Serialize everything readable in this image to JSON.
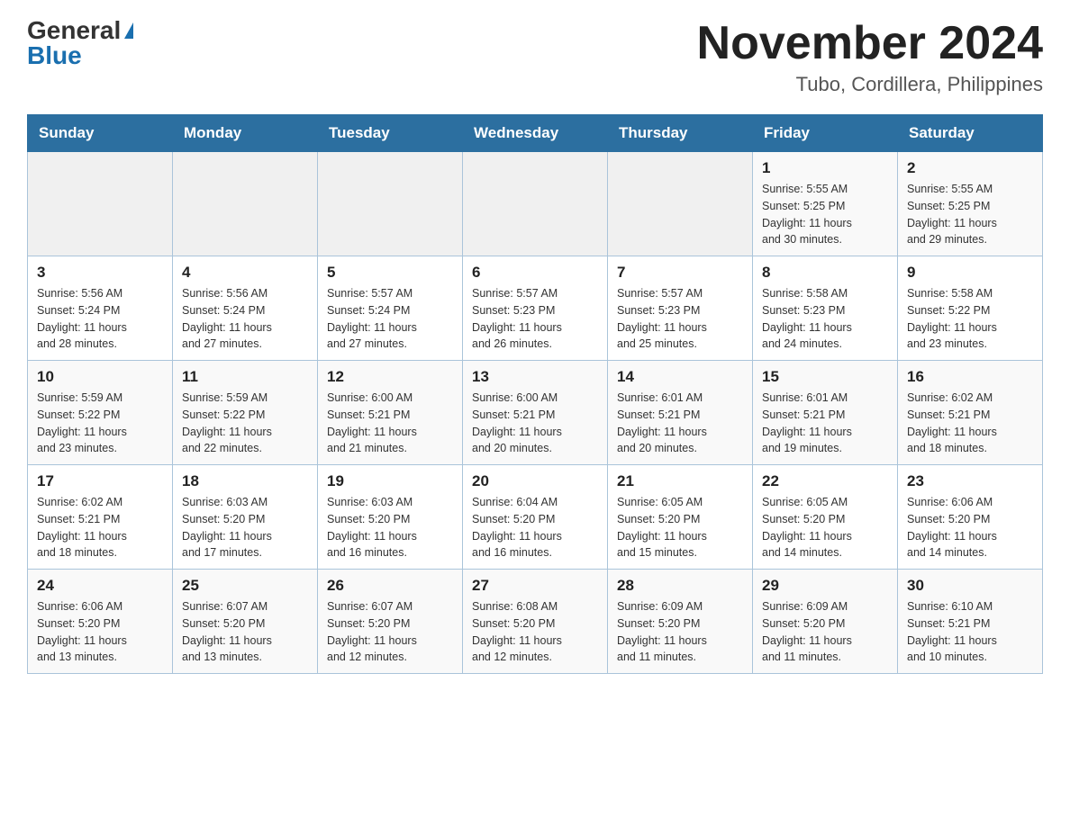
{
  "header": {
    "logo_general": "General",
    "logo_blue": "Blue",
    "month_title": "November 2024",
    "subtitle": "Tubo, Cordillera, Philippines"
  },
  "weekdays": [
    "Sunday",
    "Monday",
    "Tuesday",
    "Wednesday",
    "Thursday",
    "Friday",
    "Saturday"
  ],
  "weeks": [
    [
      {
        "day": "",
        "info": ""
      },
      {
        "day": "",
        "info": ""
      },
      {
        "day": "",
        "info": ""
      },
      {
        "day": "",
        "info": ""
      },
      {
        "day": "",
        "info": ""
      },
      {
        "day": "1",
        "info": "Sunrise: 5:55 AM\nSunset: 5:25 PM\nDaylight: 11 hours\nand 30 minutes."
      },
      {
        "day": "2",
        "info": "Sunrise: 5:55 AM\nSunset: 5:25 PM\nDaylight: 11 hours\nand 29 minutes."
      }
    ],
    [
      {
        "day": "3",
        "info": "Sunrise: 5:56 AM\nSunset: 5:24 PM\nDaylight: 11 hours\nand 28 minutes."
      },
      {
        "day": "4",
        "info": "Sunrise: 5:56 AM\nSunset: 5:24 PM\nDaylight: 11 hours\nand 27 minutes."
      },
      {
        "day": "5",
        "info": "Sunrise: 5:57 AM\nSunset: 5:24 PM\nDaylight: 11 hours\nand 27 minutes."
      },
      {
        "day": "6",
        "info": "Sunrise: 5:57 AM\nSunset: 5:23 PM\nDaylight: 11 hours\nand 26 minutes."
      },
      {
        "day": "7",
        "info": "Sunrise: 5:57 AM\nSunset: 5:23 PM\nDaylight: 11 hours\nand 25 minutes."
      },
      {
        "day": "8",
        "info": "Sunrise: 5:58 AM\nSunset: 5:23 PM\nDaylight: 11 hours\nand 24 minutes."
      },
      {
        "day": "9",
        "info": "Sunrise: 5:58 AM\nSunset: 5:22 PM\nDaylight: 11 hours\nand 23 minutes."
      }
    ],
    [
      {
        "day": "10",
        "info": "Sunrise: 5:59 AM\nSunset: 5:22 PM\nDaylight: 11 hours\nand 23 minutes."
      },
      {
        "day": "11",
        "info": "Sunrise: 5:59 AM\nSunset: 5:22 PM\nDaylight: 11 hours\nand 22 minutes."
      },
      {
        "day": "12",
        "info": "Sunrise: 6:00 AM\nSunset: 5:21 PM\nDaylight: 11 hours\nand 21 minutes."
      },
      {
        "day": "13",
        "info": "Sunrise: 6:00 AM\nSunset: 5:21 PM\nDaylight: 11 hours\nand 20 minutes."
      },
      {
        "day": "14",
        "info": "Sunrise: 6:01 AM\nSunset: 5:21 PM\nDaylight: 11 hours\nand 20 minutes."
      },
      {
        "day": "15",
        "info": "Sunrise: 6:01 AM\nSunset: 5:21 PM\nDaylight: 11 hours\nand 19 minutes."
      },
      {
        "day": "16",
        "info": "Sunrise: 6:02 AM\nSunset: 5:21 PM\nDaylight: 11 hours\nand 18 minutes."
      }
    ],
    [
      {
        "day": "17",
        "info": "Sunrise: 6:02 AM\nSunset: 5:21 PM\nDaylight: 11 hours\nand 18 minutes."
      },
      {
        "day": "18",
        "info": "Sunrise: 6:03 AM\nSunset: 5:20 PM\nDaylight: 11 hours\nand 17 minutes."
      },
      {
        "day": "19",
        "info": "Sunrise: 6:03 AM\nSunset: 5:20 PM\nDaylight: 11 hours\nand 16 minutes."
      },
      {
        "day": "20",
        "info": "Sunrise: 6:04 AM\nSunset: 5:20 PM\nDaylight: 11 hours\nand 16 minutes."
      },
      {
        "day": "21",
        "info": "Sunrise: 6:05 AM\nSunset: 5:20 PM\nDaylight: 11 hours\nand 15 minutes."
      },
      {
        "day": "22",
        "info": "Sunrise: 6:05 AM\nSunset: 5:20 PM\nDaylight: 11 hours\nand 14 minutes."
      },
      {
        "day": "23",
        "info": "Sunrise: 6:06 AM\nSunset: 5:20 PM\nDaylight: 11 hours\nand 14 minutes."
      }
    ],
    [
      {
        "day": "24",
        "info": "Sunrise: 6:06 AM\nSunset: 5:20 PM\nDaylight: 11 hours\nand 13 minutes."
      },
      {
        "day": "25",
        "info": "Sunrise: 6:07 AM\nSunset: 5:20 PM\nDaylight: 11 hours\nand 13 minutes."
      },
      {
        "day": "26",
        "info": "Sunrise: 6:07 AM\nSunset: 5:20 PM\nDaylight: 11 hours\nand 12 minutes."
      },
      {
        "day": "27",
        "info": "Sunrise: 6:08 AM\nSunset: 5:20 PM\nDaylight: 11 hours\nand 12 minutes."
      },
      {
        "day": "28",
        "info": "Sunrise: 6:09 AM\nSunset: 5:20 PM\nDaylight: 11 hours\nand 11 minutes."
      },
      {
        "day": "29",
        "info": "Sunrise: 6:09 AM\nSunset: 5:20 PM\nDaylight: 11 hours\nand 11 minutes."
      },
      {
        "day": "30",
        "info": "Sunrise: 6:10 AM\nSunset: 5:21 PM\nDaylight: 11 hours\nand 10 minutes."
      }
    ]
  ]
}
